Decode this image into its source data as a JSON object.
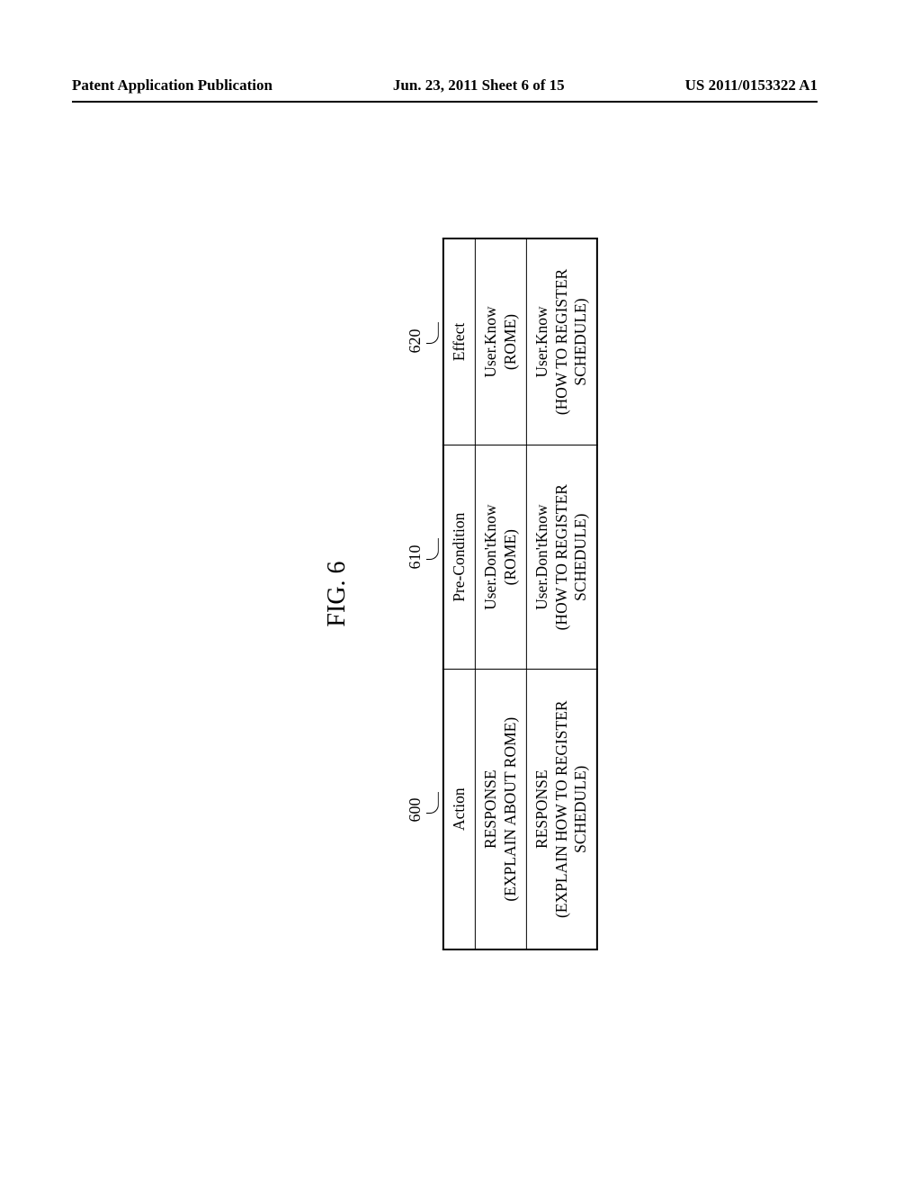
{
  "header": {
    "left": "Patent Application Publication",
    "center": "Jun. 23, 2011  Sheet 6 of 15",
    "right": "US 2011/0153322 A1"
  },
  "figure": {
    "title": "FIG. 6",
    "labels": {
      "col1": "600",
      "col2": "610",
      "col3": "620"
    },
    "table": {
      "headers": {
        "action": "Action",
        "precondition": "Pre-Condition",
        "effect": "Effect"
      },
      "rows": [
        {
          "action_line1": "RESPONSE",
          "action_line2": "(EXPLAIN ABOUT ROME)",
          "pre_line1": "User.Don'tKnow",
          "pre_line2": "(ROME)",
          "eff_line1": "User.Know",
          "eff_line2": "(ROME)"
        },
        {
          "action_line1": "RESPONSE",
          "action_line2": "(EXPLAIN HOW TO REGISTER SCHEDULE)",
          "pre_line1": "User.Don'tKnow",
          "pre_line2": "(HOW TO REGISTER SCHEDULE)",
          "eff_line1": "User.Know",
          "eff_line2": "(HOW TO REGISTER SCHEDULE)"
        }
      ]
    }
  }
}
